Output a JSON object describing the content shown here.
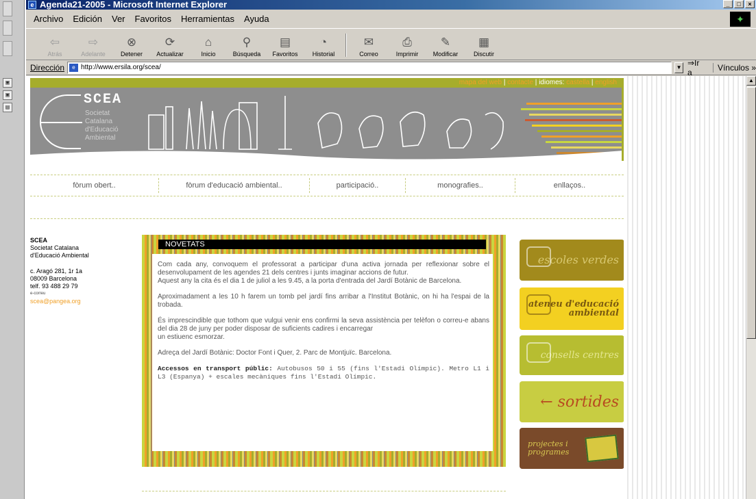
{
  "window": {
    "title": "Agenda21-2005 - Microsoft Internet Explorer"
  },
  "menu": [
    "Archivo",
    "Edición",
    "Ver",
    "Favoritos",
    "Herramientas",
    "Ayuda"
  ],
  "toolbar": {
    "back": "Atrás",
    "forward": "Adelante",
    "stop": "Detener",
    "refresh": "Actualizar",
    "home": "Inicio",
    "search": "Búsqueda",
    "favorites": "Favoritos",
    "history": "Historial",
    "mail": "Correo",
    "print": "Imprimir",
    "edit": "Modificar",
    "discuss": "Discutir"
  },
  "address": {
    "label": "Dirección",
    "url": "http://www.ersila.org/scea/",
    "go": "Ir a",
    "links": "Vínculos »"
  },
  "site": {
    "toplinks": {
      "map": "mapa del web",
      "contact": "contacte",
      "languages": "idiomes:",
      "castellano": "castella",
      "english": "english"
    },
    "logo": {
      "name": "SCEA",
      "subtitle_lines": [
        "Societat",
        "Catalana",
        "d'Educació",
        "Ambiental"
      ]
    },
    "nav": [
      "fòrum obert..",
      "fòrum d'educació ambiental..",
      "participació..",
      "monografies..",
      "enllaços.."
    ],
    "contact": {
      "name": "SCEA",
      "line1": "Societat Catalana",
      "line2": "d'Educació Ambiental",
      "address": "c. Aragó 281, 1r 1a",
      "city": "08009 Barcelona",
      "phone": "telf. 93 488 29 79",
      "email_label": "e-correu",
      "email": "scea@pangea.org"
    },
    "news": {
      "header": "NOVETATS",
      "p1": "Com cada any, convoquem el professorat a participar d'una activa jornada per reflexionar sobre el desenvolupament de les agendes 21 dels centres i junts imaginar accions de futur.",
      "p1b": "Aquest any la cita és el dia 1 de juliol a les 9.45, a la porta d'entrada del Jardí Botànic de Barcelona.",
      "p2": "Aproximadament a les 10 h farem un tomb pel jardí fins arribar a l'Institut Botànic, on hi ha l'espai de la trobada.",
      "p3": "És imprescindible que tothom que vulgui venir ens confirmi la seva assistència per telèfon o correu-e abans del dia 28 de juny per poder disposar de suficients cadires i encarregar",
      "p3b": "un estiuenc esmorzar.",
      "p4": "Adreça del Jardí Botànic: Doctor Font i Quer, 2. Parc de Montjuïc. Barcelona.",
      "p5_bold": "Accessos en transport públic:",
      "p5": " Autobusos 50 i 55 (fins l'Estadi Olímpic). Metro L1 i L3 (Espanya) + escales mecàniques fins l'Estadi Olímpic."
    },
    "buttons": {
      "b1": "escoles verdes",
      "b2": "ateneu d'educació ambiental",
      "b3": "consells centres",
      "b4": "← sortides",
      "b5": "projectes i programes"
    }
  },
  "colors": {
    "olive": "#a6ad2c",
    "orange": "#f0a028",
    "banner_gray": "#8e8e8e"
  }
}
